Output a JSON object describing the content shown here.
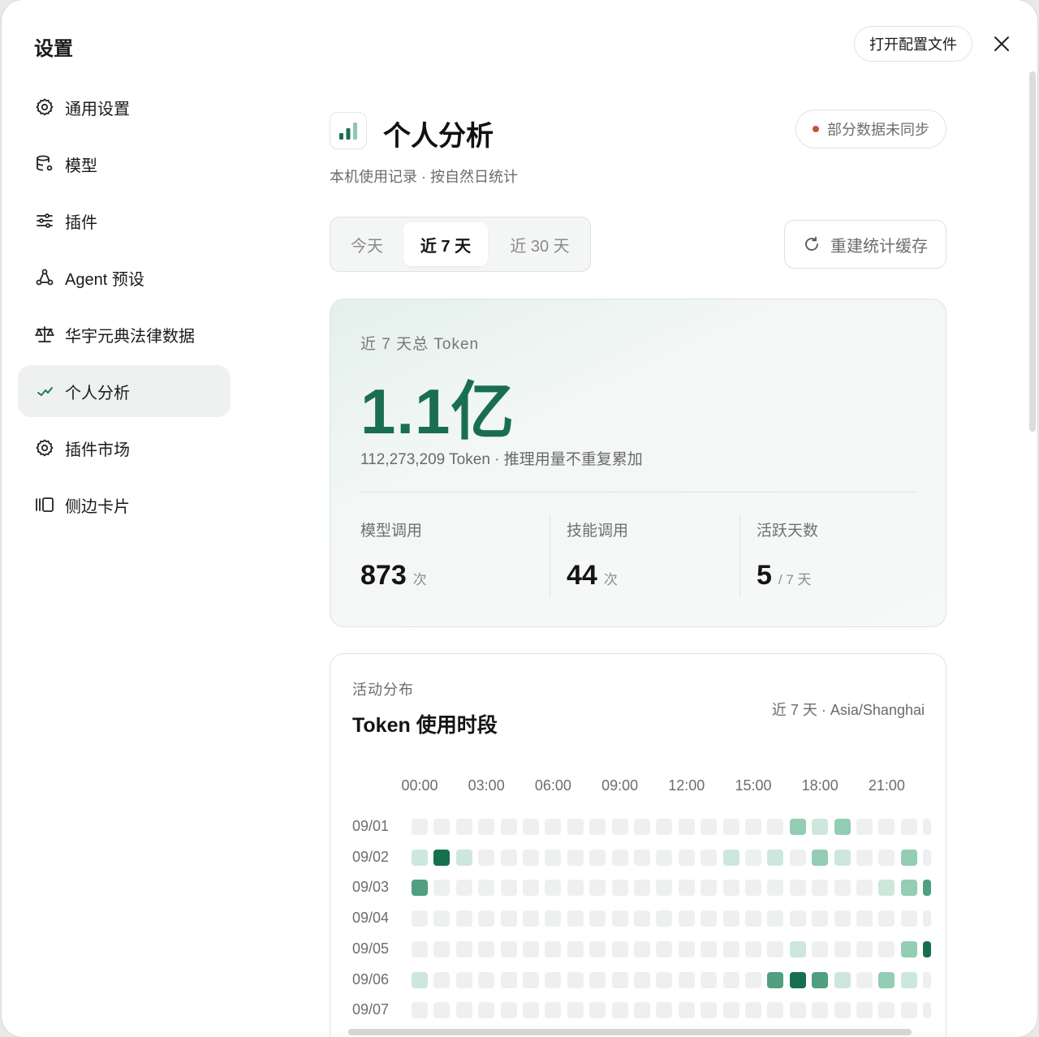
{
  "window": {
    "title": "设置",
    "open_config_label": "打开配置文件"
  },
  "sidebar": {
    "items": [
      {
        "label": "通用设置",
        "icon": "gear-icon",
        "active": false
      },
      {
        "label": "模型",
        "icon": "database-gear-icon",
        "active": false
      },
      {
        "label": "插件",
        "icon": "sliders-icon",
        "active": false
      },
      {
        "label": "Agent 预设",
        "icon": "agent-nodes-icon",
        "active": false
      },
      {
        "label": "华宇元典法律数据",
        "icon": "scale-icon",
        "active": false
      },
      {
        "label": "个人分析",
        "icon": "trend-icon",
        "active": true
      },
      {
        "label": "插件市场",
        "icon": "gear-icon",
        "active": false
      },
      {
        "label": "侧边卡片",
        "icon": "side-card-icon",
        "active": false
      }
    ]
  },
  "page": {
    "title": "个人分析",
    "subtitle": "本机使用记录 · 按自然日统计",
    "sync_status": "部分数据未同步",
    "sync_status_color": "#c9503a",
    "ranges": [
      "今天",
      "近 7 天",
      "近 30 天"
    ],
    "selected_range": "近 7 天",
    "rebuild_label": "重建统计缓存"
  },
  "token_summary": {
    "label": "近 7 天总 Token",
    "total_display": "1.1亿",
    "detail": "112,273,209 Token · 推理用量不重复累加",
    "stats": [
      {
        "label": "模型调用",
        "value": "873",
        "unit": "次"
      },
      {
        "label": "技能调用",
        "value": "44",
        "unit": "次"
      },
      {
        "label": "活跃天数",
        "value": "5",
        "unit": "/ 7 天"
      }
    ]
  },
  "activity": {
    "kicker": "活动分布",
    "title": "Token 使用时段",
    "meta": "近 7 天 · Asia/Shanghai",
    "hour_labels": [
      "00:00",
      "03:00",
      "06:00",
      "09:00",
      "12:00",
      "15:00",
      "18:00",
      "21:00"
    ],
    "days": [
      "09/01",
      "09/02",
      "09/03",
      "09/04",
      "09/05",
      "09/06",
      "09/07"
    ],
    "levels": [
      [
        0,
        0,
        0,
        0,
        0,
        0,
        0,
        0,
        0,
        0,
        0,
        0,
        0,
        0,
        0,
        0,
        0,
        2,
        1,
        2,
        0,
        0,
        0,
        0
      ],
      [
        1,
        4,
        1,
        0,
        0,
        0,
        0,
        0,
        0,
        0,
        0,
        0,
        0,
        0,
        1,
        0,
        1,
        0,
        2,
        1,
        0,
        0,
        2,
        0
      ],
      [
        3,
        0,
        0,
        0,
        0,
        0,
        0,
        0,
        0,
        0,
        0,
        0,
        0,
        0,
        0,
        0,
        0,
        0,
        0,
        0,
        0,
        1,
        2,
        3
      ],
      [
        0,
        0,
        0,
        0,
        0,
        0,
        0,
        0,
        0,
        0,
        0,
        0,
        0,
        0,
        0,
        0,
        0,
        0,
        0,
        0,
        0,
        0,
        0,
        0
      ],
      [
        0,
        0,
        0,
        0,
        0,
        0,
        0,
        0,
        0,
        0,
        0,
        0,
        0,
        0,
        0,
        0,
        0,
        1,
        0,
        0,
        0,
        0,
        2,
        4
      ],
      [
        1,
        0,
        0,
        0,
        0,
        0,
        0,
        0,
        0,
        0,
        0,
        0,
        0,
        0,
        0,
        0,
        3,
        4,
        3,
        1,
        0,
        2,
        1,
        0
      ],
      [
        0,
        0,
        0,
        0,
        0,
        0,
        0,
        0,
        0,
        0,
        0,
        0,
        0,
        0,
        0,
        0,
        0,
        0,
        0,
        0,
        0,
        0,
        0,
        0
      ]
    ],
    "level_colors": [
      "#eef0f0",
      "#cde7dc",
      "#93cdb4",
      "#4f9f80",
      "#16704f"
    ]
  }
}
